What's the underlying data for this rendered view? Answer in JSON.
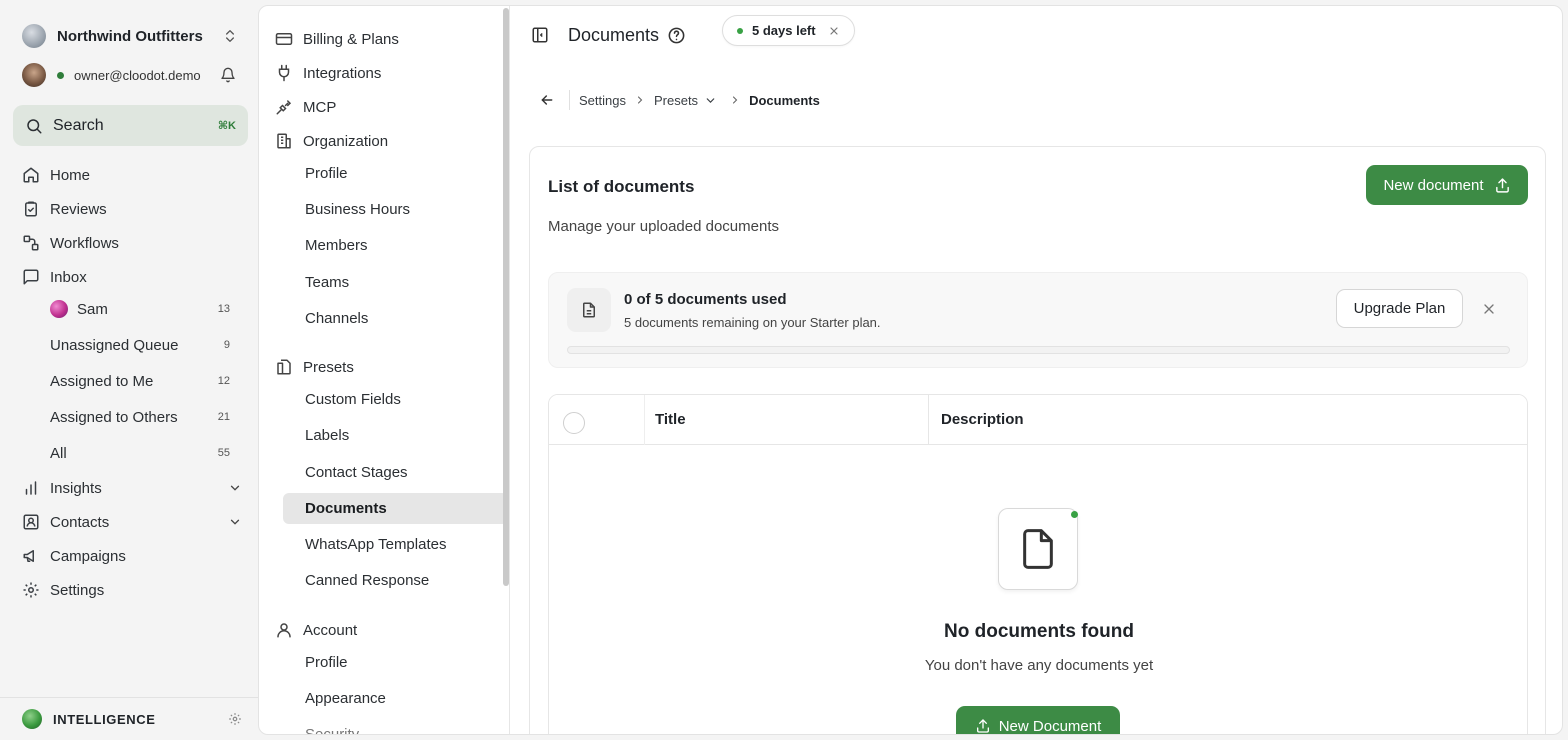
{
  "org": {
    "name": "Northwind Outfitters"
  },
  "user": {
    "email": "owner@cloodot.demo"
  },
  "search": {
    "label": "Search",
    "shortcut": "⌘K"
  },
  "nav": {
    "home": "Home",
    "reviews": "Reviews",
    "workflows": "Workflows",
    "inbox": "Inbox",
    "inbox_items": [
      {
        "label": "Sam",
        "count": "13"
      },
      {
        "label": "Unassigned Queue",
        "count": "9"
      },
      {
        "label": "Assigned to Me",
        "count": "12"
      },
      {
        "label": "Assigned to Others",
        "count": "21"
      },
      {
        "label": "All",
        "count": "55"
      }
    ],
    "insights": "Insights",
    "contacts": "Contacts",
    "campaigns": "Campaigns",
    "settings": "Settings"
  },
  "intelligence": {
    "label": "INTELLIGENCE"
  },
  "settings_menu": {
    "billing": "Billing & Plans",
    "integrations": "Integrations",
    "mcp": "MCP",
    "organization": "Organization",
    "organization_items": [
      "Profile",
      "Business Hours",
      "Members",
      "Teams",
      "Channels"
    ],
    "presets": "Presets",
    "presets_items": [
      "Custom Fields",
      "Labels",
      "Contact Stages",
      "Documents",
      "WhatsApp Templates",
      "Canned Response"
    ],
    "account": "Account",
    "account_items": [
      "Profile",
      "Appearance",
      "Security"
    ]
  },
  "header": {
    "title": "Documents",
    "trial": "5 days left"
  },
  "breadcrumb": {
    "settings": "Settings",
    "presets": "Presets",
    "current": "Documents"
  },
  "panel": {
    "title": "List of documents",
    "subtitle": "Manage your uploaded documents",
    "new_button": "New document"
  },
  "usage": {
    "title": "0 of 5 documents used",
    "subtitle": "5 documents remaining on your Starter plan.",
    "upgrade": "Upgrade Plan",
    "used": 0,
    "limit": 5
  },
  "table": {
    "columns": [
      "Title",
      "Description"
    ],
    "empty_title": "No documents found",
    "empty_subtitle": "You don't have any documents yet",
    "empty_button": "New Document"
  },
  "colors": {
    "accent": "#3d8b45",
    "online": "#2f7d3a"
  }
}
